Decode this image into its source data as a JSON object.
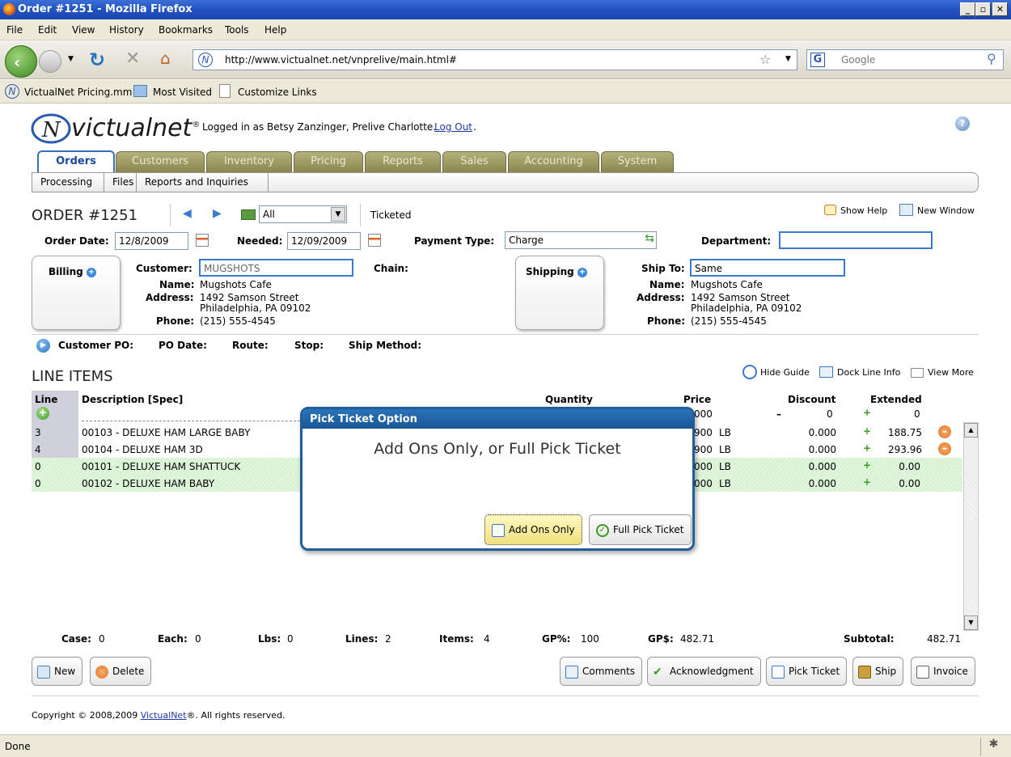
{
  "window": {
    "title": "Order #1251 - Mozilla Firefox"
  },
  "menu": [
    "File",
    "Edit",
    "View",
    "History",
    "Bookmarks",
    "Tools",
    "Help"
  ],
  "browser": {
    "url": "http://www.victualnet.net/vnprelive/main.html#",
    "search_placeholder": "Google"
  },
  "bookmarks": [
    "VictualNet Pricing.mm",
    "Most Visited",
    "Customize Links"
  ],
  "app": {
    "brand": "victualnet",
    "logged_in": "Logged in as Betsy Zanzinger, Prelive Charlotte.",
    "logout": "Log Out",
    "tabs": [
      "Orders",
      "Customers",
      "Inventory",
      "Pricing",
      "Reports",
      "Sales",
      "Accounting",
      "System"
    ],
    "subtabs": [
      "Processing",
      "Files",
      "Reports and Inquiries"
    ]
  },
  "order": {
    "title": "ORDER #1251",
    "filter": "All",
    "status": "Ticketed",
    "show_help": "Show Help",
    "new_window": "New Window",
    "order_date_label": "Order Date:",
    "order_date": "12/8/2009",
    "needed_label": "Needed:",
    "needed": "12/09/2009",
    "payment_type_label": "Payment Type:",
    "payment_type": "Charge",
    "department_label": "Department:",
    "department": ""
  },
  "billing": {
    "tab": "Billing",
    "customer_label": "Customer:",
    "customer": "MUGSHOTS",
    "chain_label": "Chain:",
    "name_label": "Name:",
    "name": "Mugshots Cafe",
    "address_label": "Address:",
    "address1": "1492 Samson Street",
    "address2": "Philadelphia, PA 09102",
    "phone_label": "Phone:",
    "phone": "(215) 555-4545"
  },
  "shipping": {
    "tab": "Shipping",
    "shipto_label": "Ship To:",
    "shipto": "Same",
    "name_label": "Name:",
    "name": "Mugshots Cafe",
    "address_label": "Address:",
    "address1": "1492 Samson Street",
    "address2": "Philadelphia, PA 09102",
    "phone_label": "Phone:",
    "phone": "(215) 555-4545"
  },
  "details": [
    "Customer PO:",
    "PO Date:",
    "Route:",
    "Stop:",
    "Ship Method:"
  ],
  "lineitems": {
    "title": "LINE ITEMS",
    "hide_guide": "Hide Guide",
    "dock": "Dock Line Info",
    "view_more": "View More",
    "headers": {
      "line": "Line",
      "desc": "Description [Spec]",
      "qty": "Quantity",
      "price": "Price",
      "discount": "Discount",
      "extended": "Extended"
    },
    "entry": {
      "price": "000",
      "discount": "0",
      "extended": "0"
    },
    "rows": [
      {
        "line": "3",
        "desc": "00103 - DELUXE HAM LARGE BABY",
        "price": "900",
        "unit": "LB",
        "discount": "0.000",
        "extended": "188.75",
        "green": false
      },
      {
        "line": "4",
        "desc": "00104 - DELUXE HAM 3D",
        "price": "900",
        "unit": "LB",
        "discount": "0.000",
        "extended": "293.96",
        "green": false
      },
      {
        "line": "0",
        "desc": "00101 - DELUXE HAM SHATTUCK",
        "price": "000",
        "unit": "LB",
        "discount": "0.000",
        "extended": "0.00",
        "green": true
      },
      {
        "line": "0",
        "desc": "00102 - DELUXE HAM BABY",
        "price": "000",
        "unit": "LB",
        "discount": "0.000",
        "extended": "0.00",
        "green": true
      }
    ]
  },
  "totals": {
    "case_label": "Case:",
    "case": "0",
    "each_label": "Each:",
    "each": "0",
    "lbs_label": "Lbs:",
    "lbs": "0",
    "lines_label": "Lines:",
    "lines": "2",
    "items_label": "Items:",
    "items": "4",
    "gpp_label": "GP%:",
    "gpp": "100",
    "gpd_label": "GP$:",
    "gpd": "482.71",
    "subtotal_label": "Subtotal:",
    "subtotal": "482.71"
  },
  "buttons": {
    "new": "New",
    "delete": "Delete",
    "comments": "Comments",
    "ack": "Acknowledgment",
    "pick": "Pick Ticket",
    "ship": "Ship",
    "invoice": "Invoice"
  },
  "dialog": {
    "title": "Pick Ticket Option",
    "message": "Add Ons Only, or Full Pick Ticket",
    "addons": "Add Ons Only",
    "full": "Full Pick Ticket"
  },
  "footer": {
    "copyright": "Copyright © 2008,2009",
    "link": "VictualNet",
    "rest": "®. All rights reserved."
  },
  "statusbar": "Done"
}
